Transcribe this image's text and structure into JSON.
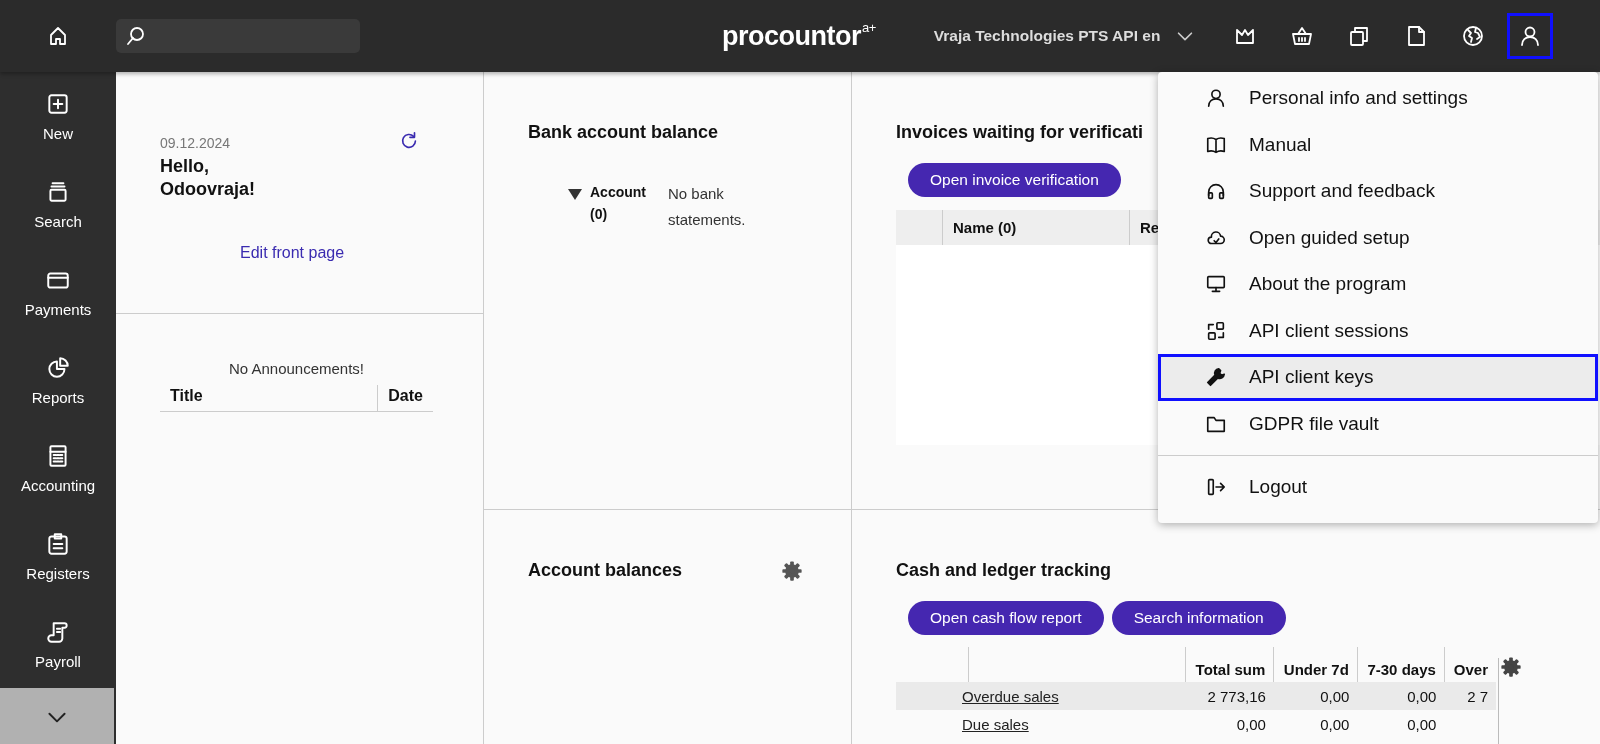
{
  "top_bar": {
    "logo": {
      "name": "procountor",
      "mark": "a+"
    },
    "company": "Vraja Technologies PTS API en",
    "tools": [
      {
        "kind": "crown",
        "selected": false
      },
      {
        "kind": "basket",
        "selected": false
      },
      {
        "kind": "copies",
        "selected": false
      },
      {
        "kind": "document",
        "selected": false
      },
      {
        "kind": "globe",
        "selected": false
      },
      {
        "kind": "user",
        "selected": true
      }
    ]
  },
  "sidebar": {
    "items": [
      {
        "kind": "new",
        "label": "New"
      },
      {
        "kind": "search",
        "label": "Search"
      },
      {
        "kind": "payments",
        "label": "Payments"
      },
      {
        "kind": "reports",
        "label": "Reports"
      },
      {
        "kind": "accounting",
        "label": "Accounting"
      },
      {
        "kind": "registers",
        "label": "Registers"
      },
      {
        "kind": "payroll",
        "label": "Payroll"
      }
    ]
  },
  "greeting": {
    "date": "09.12.2024",
    "title": "Hello, Odoovraja!",
    "link": "Edit front page"
  },
  "announcements": {
    "message": "No Announcements!",
    "columns": [
      "Title",
      "Date"
    ]
  },
  "bank_balance": {
    "title": "Bank account balance",
    "tree": [
      {
        "label": "Account (0)",
        "expanded": true
      }
    ],
    "message": "No bank statements."
  },
  "invoices": {
    "title": "Invoices waiting for verificati",
    "button": "Open invoice verification",
    "columns": [
      "Name (0)",
      "Re"
    ]
  },
  "account_balances": {
    "title": "Account balances"
  },
  "cash_tracking": {
    "title": "Cash and ledger tracking",
    "buttons": [
      "Open cash flow report",
      "Search information"
    ],
    "columns": [
      "Total sum",
      "Under 7d",
      "7-30 days",
      "Over"
    ],
    "rows": [
      {
        "label": "Overdue sales",
        "values": [
          "2 773,16",
          "0,00",
          "0,00",
          "2 7"
        ],
        "selected": true
      },
      {
        "label": "Due sales",
        "values": [
          "0,00",
          "0,00",
          "0,00"
        ],
        "selected": false
      }
    ]
  },
  "user_menu": {
    "items": [
      {
        "kind": "person",
        "label": "Personal info and settings",
        "selected": false
      },
      {
        "kind": "book",
        "label": "Manual",
        "selected": false
      },
      {
        "kind": "headset",
        "label": "Support and feedback",
        "selected": false
      },
      {
        "kind": "cloud",
        "label": "Open guided setup",
        "selected": false
      },
      {
        "kind": "monitor",
        "label": "About the program",
        "selected": false
      },
      {
        "kind": "sessions",
        "label": "API client sessions",
        "selected": false
      },
      {
        "kind": "wrench",
        "label": "API client keys",
        "selected": true
      },
      {
        "kind": "folder",
        "label": "GDPR file vault",
        "selected": false
      }
    ],
    "footer_items": [
      {
        "kind": "logout",
        "label": "Logout",
        "selected": false
      }
    ]
  }
}
